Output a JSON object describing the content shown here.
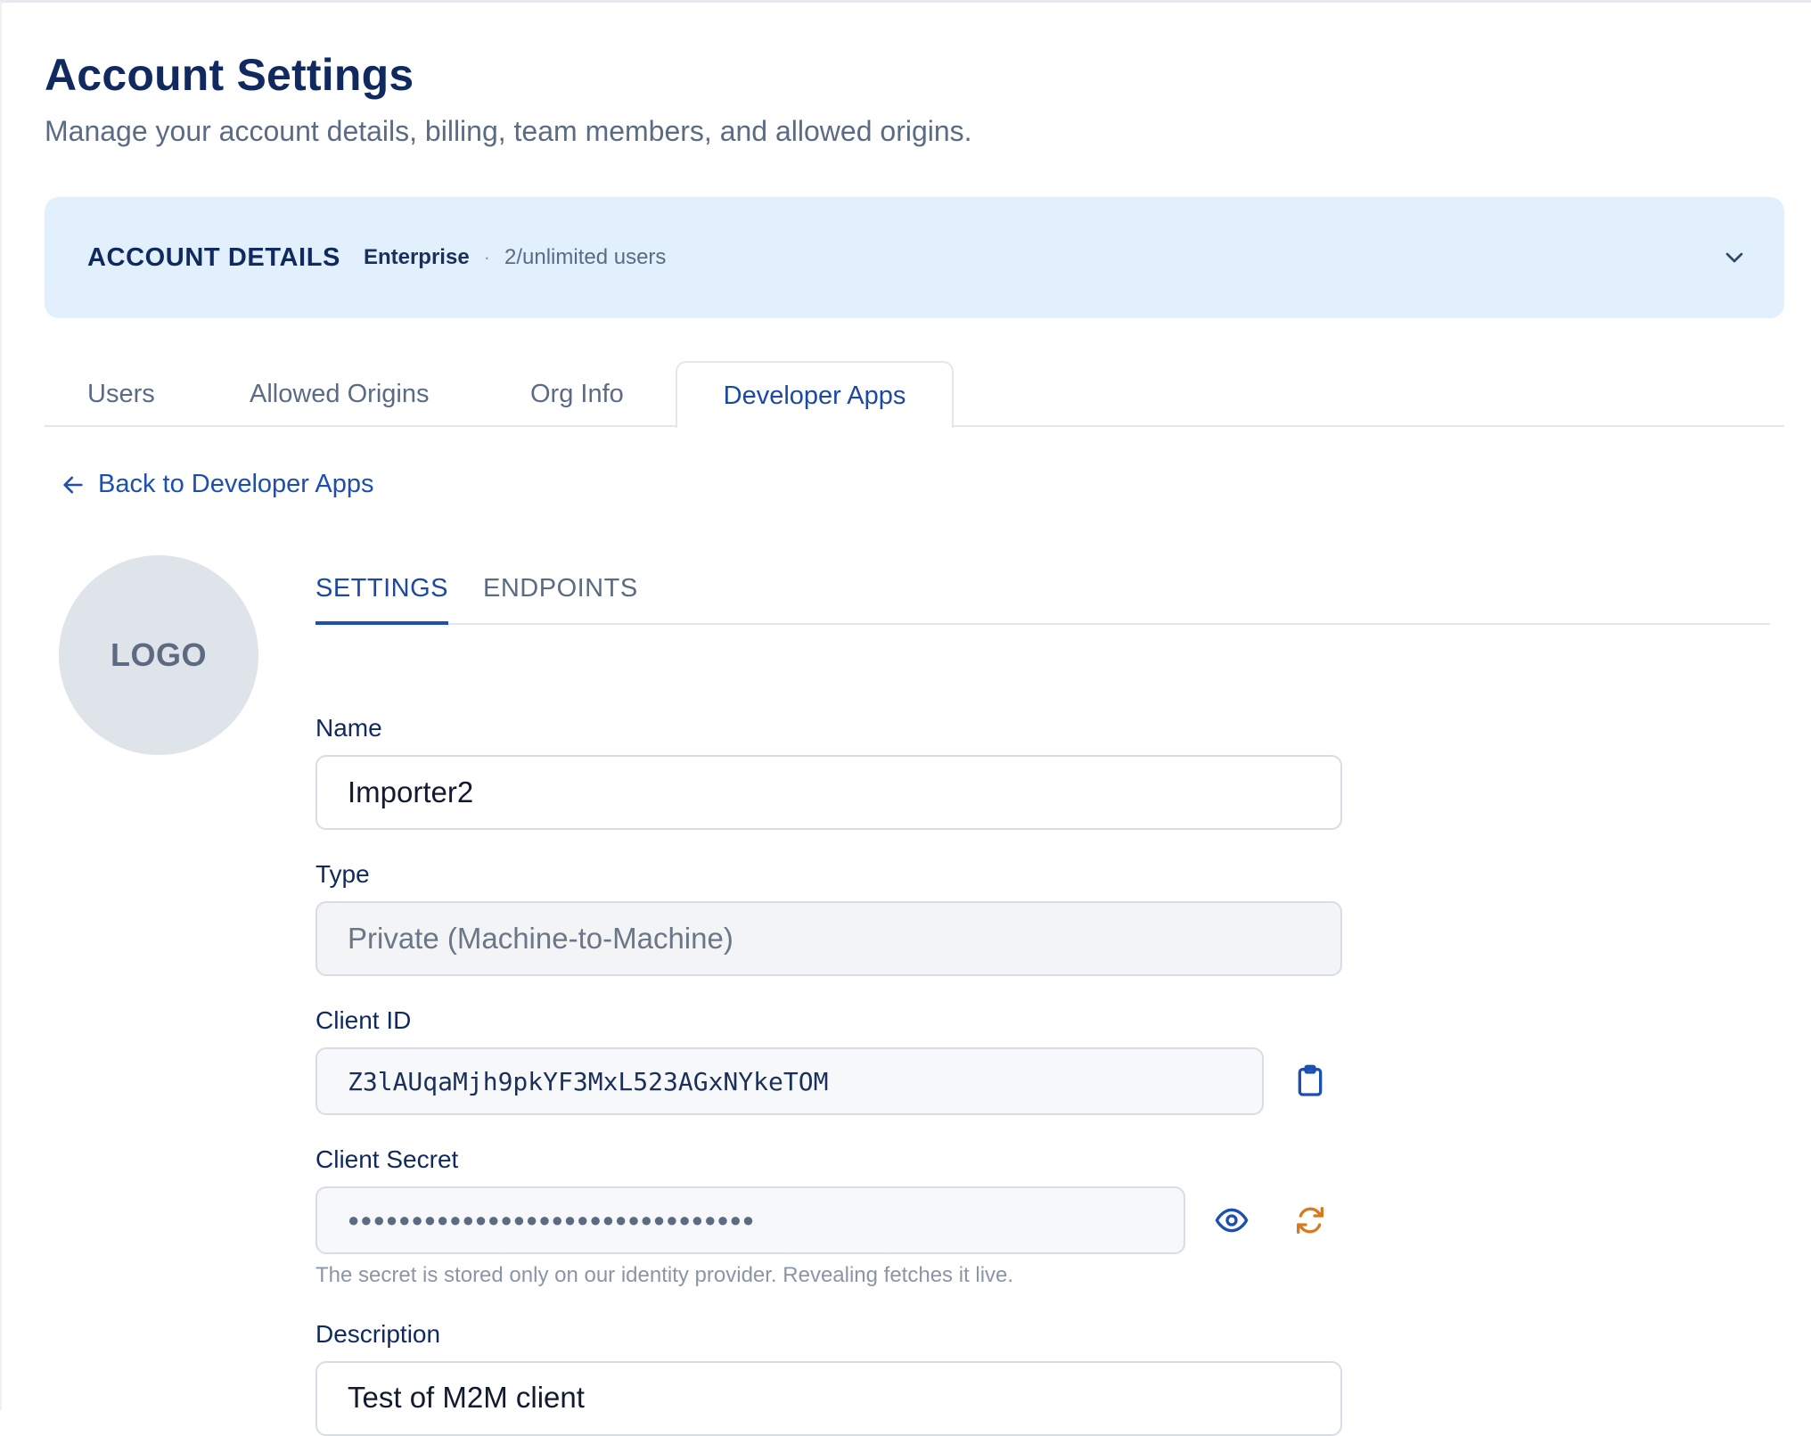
{
  "page": {
    "title": "Account Settings",
    "subtitle": "Manage your account details, billing, team members, and allowed origins."
  },
  "account_banner": {
    "title": "ACCOUNT DETAILS",
    "plan": "Enterprise",
    "separator": "·",
    "users": "2/unlimited users",
    "expand_icon": "chevron-down-icon"
  },
  "tabs": [
    {
      "label": "Users",
      "active": false
    },
    {
      "label": "Allowed Origins",
      "active": false
    },
    {
      "label": "Org Info",
      "active": false
    },
    {
      "label": "Developer Apps",
      "active": true
    }
  ],
  "back_link": {
    "label": "Back to Developer Apps",
    "icon": "arrow-left-icon"
  },
  "app": {
    "logo_text": "LOGO",
    "subtabs": [
      {
        "label": "SETTINGS",
        "active": true
      },
      {
        "label": "ENDPOINTS",
        "active": false
      }
    ],
    "fields": {
      "name": {
        "label": "Name",
        "value": "Importer2"
      },
      "type": {
        "label": "Type",
        "value": "Private (Machine-to-Machine)"
      },
      "client_id": {
        "label": "Client ID",
        "value": "Z3lAUqaMjh9pkYF3MxL523AGxNYkeTOM",
        "copy_icon": "clipboard-icon"
      },
      "client_secret": {
        "label": "Client Secret",
        "value": "●●●●●●●●●●●●●●●●●●●●●●●●●●●●●●●●",
        "reveal_icon": "eye-icon",
        "rotate_icon": "refresh-icon",
        "help": "The secret is stored only on our identity provider. Revealing fetches it live."
      },
      "description": {
        "label": "Description",
        "value": "Test of M2M client"
      }
    }
  },
  "colors": {
    "accent": "#1d4fb0",
    "banner_bg": "#e1f0fc",
    "rotate_icon": "#d9791f",
    "heading": "#10295e"
  }
}
